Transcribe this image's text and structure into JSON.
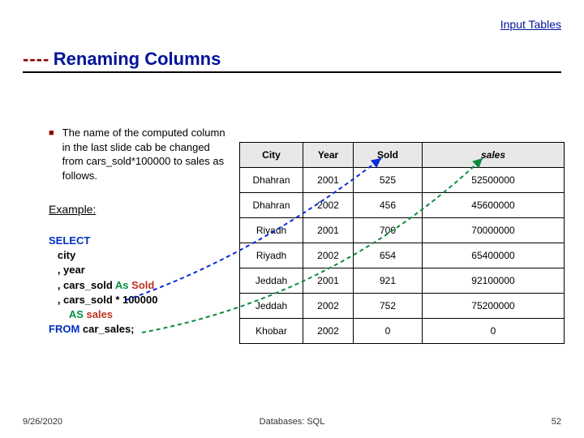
{
  "link": {
    "label": "Input Tables"
  },
  "heading": {
    "dashes": "----",
    "title": "Renaming Columns"
  },
  "bullet": {
    "text_full": "The name of the computed column in the last slide cab be changed from cars_sold*100000 to sales  as follows."
  },
  "example_label": "Example:",
  "sql": {
    "select": "SELECT",
    "from": "FROM",
    "as1": "As",
    "as2": "AS",
    "col_city": "   city",
    "col_year": "   , year",
    "col_cars": "   , cars_sold ",
    "alias_sold": "Sold",
    "col_mul": "   , cars_sold * 100000",
    "alias_sales_line": "       ",
    "alias_sales": "sales",
    "from_tbl": " car_sales;"
  },
  "table": {
    "headers": [
      "City",
      "Year",
      "Sold",
      "sales"
    ],
    "rows": [
      [
        "Dhahran",
        "2001",
        "525",
        "52500000"
      ],
      [
        "Dhahran",
        "2002",
        "456",
        "45600000"
      ],
      [
        "Riyadh",
        "2001",
        "700",
        "70000000"
      ],
      [
        "Riyadh",
        "2002",
        "654",
        "65400000"
      ],
      [
        "Jeddah",
        "2001",
        "921",
        "92100000"
      ],
      [
        "Jeddah",
        "2002",
        "752",
        "75200000"
      ],
      [
        "Khobar",
        "2002",
        "0",
        "0"
      ]
    ]
  },
  "chart_data": {
    "type": "table",
    "title": "Renaming Columns — result of SELECT with aliased computed column",
    "columns": [
      "City",
      "Year",
      "Sold",
      "sales"
    ],
    "rows": [
      {
        "City": "Dhahran",
        "Year": 2001,
        "Sold": 525,
        "sales": 52500000
      },
      {
        "City": "Dhahran",
        "Year": 2002,
        "Sold": 456,
        "sales": 45600000
      },
      {
        "City": "Riyadh",
        "Year": 2001,
        "Sold": 700,
        "sales": 70000000
      },
      {
        "City": "Riyadh",
        "Year": 2002,
        "Sold": 654,
        "sales": 65400000
      },
      {
        "City": "Jeddah",
        "Year": 2001,
        "Sold": 921,
        "sales": 92100000
      },
      {
        "City": "Jeddah",
        "Year": 2002,
        "Sold": 752,
        "sales": 75200000
      },
      {
        "City": "Khobar",
        "Year": 2002,
        "Sold": 0,
        "sales": 0
      }
    ]
  },
  "footer": {
    "date": "9/26/2020",
    "course": "Databases: SQL",
    "page": "52"
  }
}
